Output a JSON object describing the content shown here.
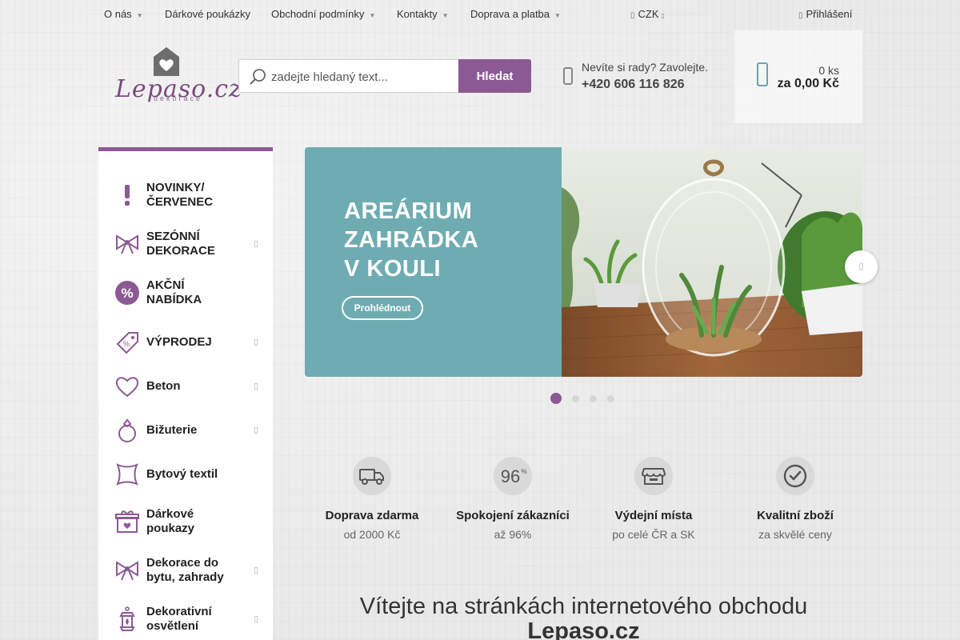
{
  "topnav": {
    "items": [
      {
        "label": "O nás"
      },
      {
        "label": "Dárkové poukázky"
      },
      {
        "label": "Obchodní podmínky"
      },
      {
        "label": "Kontakty"
      },
      {
        "label": "Doprava a platba"
      }
    ],
    "currency": "CZK",
    "login": "Přihlášení"
  },
  "logo": {
    "text": "Lepaso.cz",
    "subtitle": "dekorace"
  },
  "search": {
    "placeholder": "zadejte hledaný text...",
    "button_label": "Hledat"
  },
  "phone": {
    "line1": "Nevíte si rady? Zavolejte.",
    "number": "+420 606 116 826"
  },
  "cart": {
    "count": "0 ks",
    "total": "za 0,00 Kč"
  },
  "categories": [
    {
      "label": "NOVINKY/ ČERVENEC",
      "icon": "exclamation-icon",
      "has_submenu": false
    },
    {
      "label": "SEZÓNNÍ DEKORACE",
      "icon": "bow-icon",
      "has_submenu": true
    },
    {
      "label": "AKČNÍ NABÍDKA",
      "icon": "percent-icon",
      "has_submenu": false
    },
    {
      "label": "VÝPRODEJ",
      "icon": "tag-icon",
      "has_submenu": true
    },
    {
      "label": "Beton",
      "icon": "heart-icon",
      "has_submenu": true
    },
    {
      "label": "Bižuterie",
      "icon": "ring-icon",
      "has_submenu": true
    },
    {
      "label": "Bytový textil",
      "icon": "cushion-icon",
      "has_submenu": false
    },
    {
      "label": "Dárkové poukazy",
      "icon": "gift-icon",
      "has_submenu": false
    },
    {
      "label": "Dekorace do bytu, zahrady",
      "icon": "bow-icon",
      "has_submenu": true
    },
    {
      "label": "Dekorativní osvětlení",
      "icon": "lantern-icon",
      "has_submenu": true
    }
  ],
  "banner": {
    "title_lines": [
      "AREÁRIUM",
      "ZAHRÁDKA",
      "V KOULI"
    ],
    "cta": "Prohlédnout",
    "slide_count": 4,
    "active_slide": 1
  },
  "benefits": [
    {
      "title": "Doprava zdarma",
      "subtitle": "od 2000 Kč",
      "icon": "truck-icon"
    },
    {
      "title": "Spokojení zákazníci",
      "subtitle": "až 96%",
      "icon": "percent-96-icon",
      "icon_text": "96",
      "icon_sup": "%"
    },
    {
      "title": "Výdejní místa",
      "subtitle": "po celé ČR a SK",
      "icon": "store-icon"
    },
    {
      "title": "Kvalitní zboží",
      "subtitle": "za skvělé ceny",
      "icon": "check-icon"
    }
  ],
  "welcome": {
    "line1": "Vítejte na stránkách internetového obchodu",
    "line2": "Lepaso.cz"
  },
  "colors": {
    "accent": "#8b5a94",
    "banner_teal": "#6facb2"
  }
}
